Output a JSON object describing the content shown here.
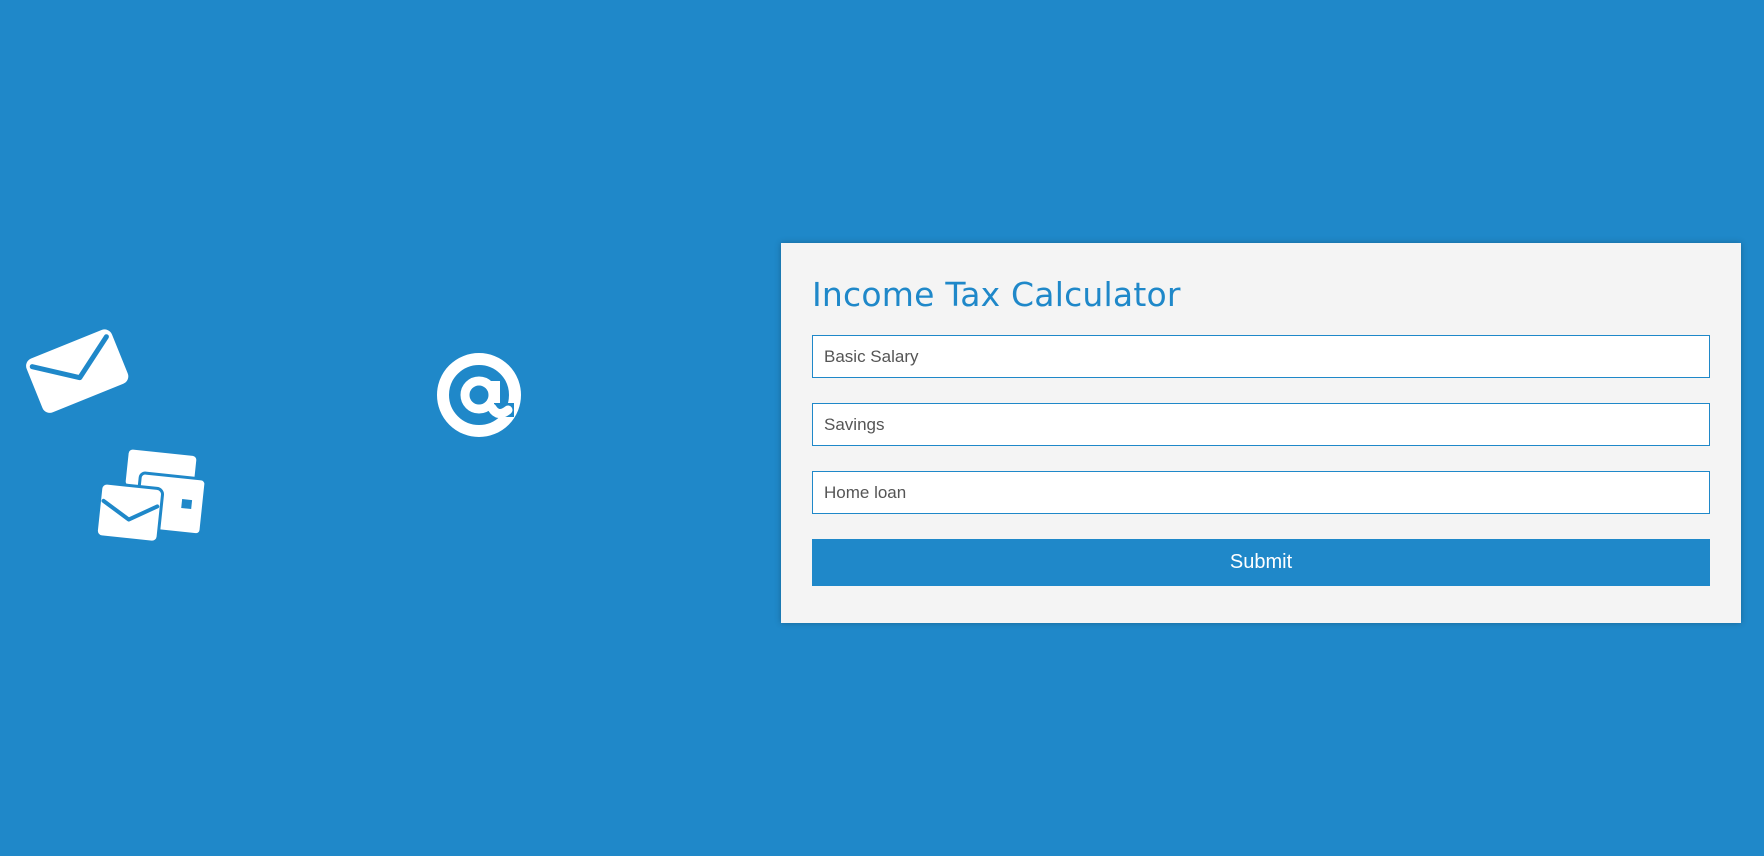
{
  "form": {
    "title": "Income Tax Calculator",
    "fields": [
      {
        "placeholder": "Basic Salary",
        "value": ""
      },
      {
        "placeholder": "Savings",
        "value": ""
      },
      {
        "placeholder": "Home loan",
        "value": ""
      }
    ],
    "submit_label": "Submit"
  },
  "decor": {
    "icons": [
      "envelope-icon",
      "at-sign-icon",
      "stacked-envelopes-icon"
    ]
  },
  "colors": {
    "background": "#1f88c9",
    "card": "#f4f4f4",
    "accent": "#1f88c9",
    "icon": "#ffffff"
  }
}
